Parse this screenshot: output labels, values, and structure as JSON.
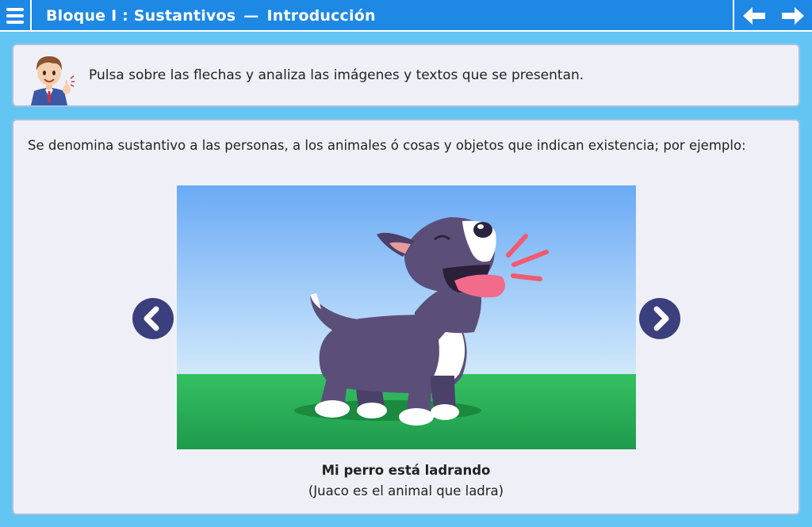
{
  "header": {
    "title_part1": "Bloque I : Sustantivos",
    "separator": "—",
    "title_part2": "Introducción",
    "menu_icon": "hamburger-menu-icon",
    "prev_icon": "arrow-left-icon",
    "next_icon": "arrow-right-icon"
  },
  "instruction": {
    "text": "Pulsa sobre las flechas y analiza las imágenes y textos que se presentan.",
    "avatar_icon": "teacher-avatar-icon"
  },
  "content": {
    "paragraph": "Se denomina sustantivo a las personas, a los animales ó cosas y objetos que indican existencia; por ejemplo:",
    "image_subject": "barking-dog-illustration",
    "caption": "Mi perro está ladrando",
    "subcaption": "(Juaco es el animal que ladra)",
    "carousel_prev_icon": "chevron-left-icon",
    "carousel_next_icon": "chevron-right-icon"
  },
  "colors": {
    "topbar": "#1e88e5",
    "page_bg": "#63c6f2",
    "panel_bg": "#eff0f7",
    "panel_border": "#a9bde4",
    "carousel_button": "#3b3f7d"
  }
}
